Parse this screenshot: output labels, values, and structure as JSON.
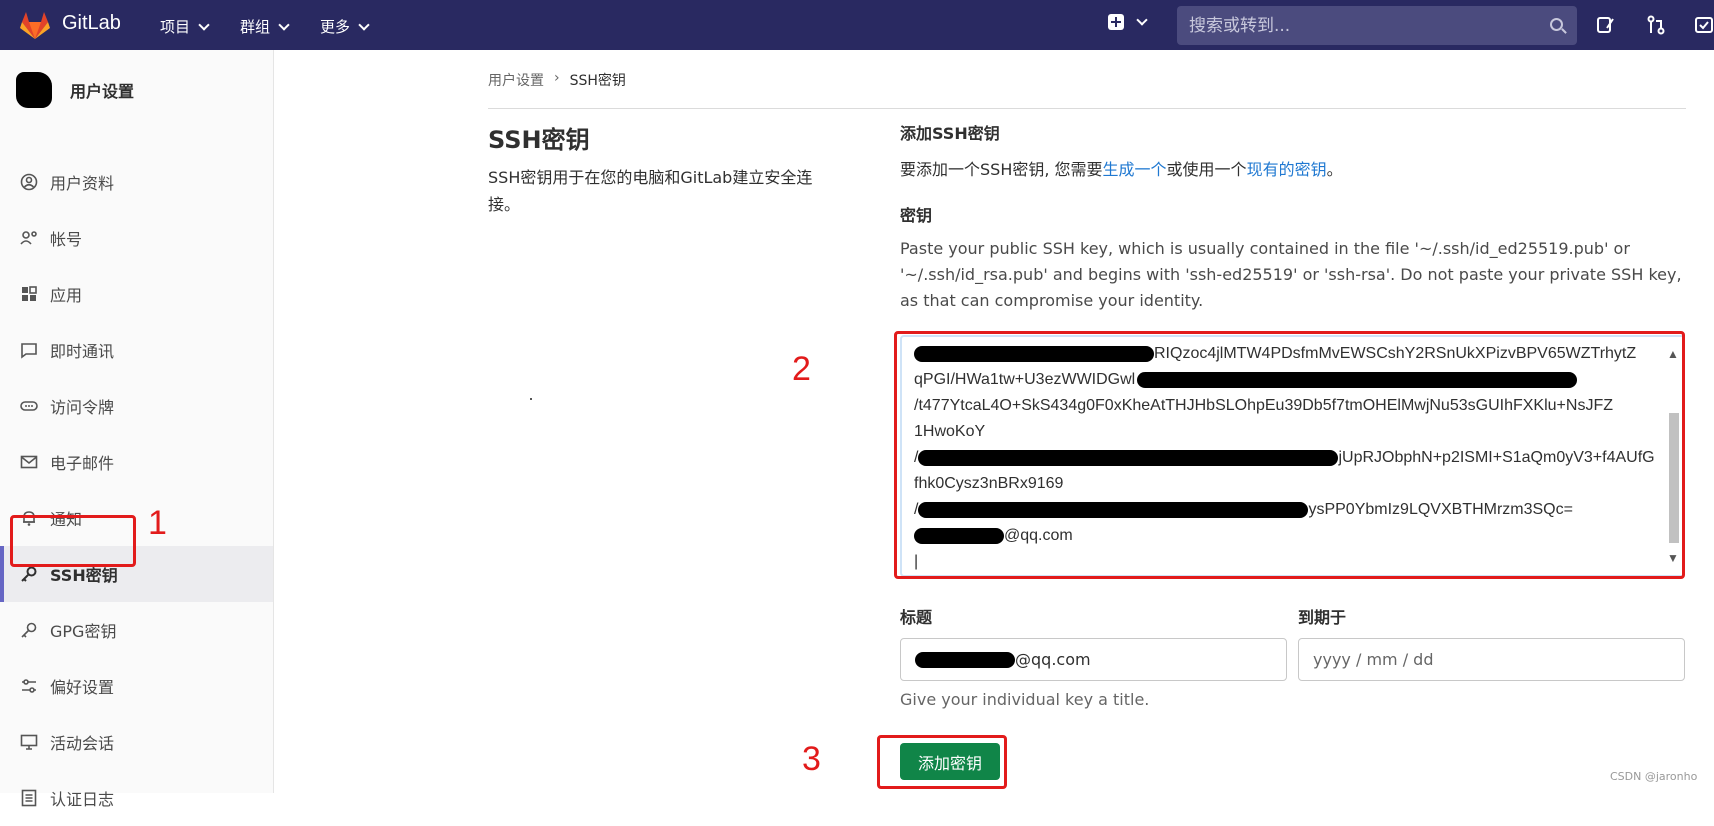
{
  "topbar": {
    "brand": "GitLab",
    "menus": [
      "项目",
      "群组",
      "更多"
    ],
    "search_placeholder": "搜索或转到..."
  },
  "sidebar": {
    "title": "用户设置",
    "items": [
      {
        "label": "用户资料",
        "icon": "profile-icon"
      },
      {
        "label": "帐号",
        "icon": "account-icon"
      },
      {
        "label": "应用",
        "icon": "applications-icon"
      },
      {
        "label": "即时通讯",
        "icon": "chat-icon"
      },
      {
        "label": "访问令牌",
        "icon": "token-icon"
      },
      {
        "label": "电子邮件",
        "icon": "email-icon"
      },
      {
        "label": "通知",
        "icon": "notifications-icon"
      },
      {
        "label": "SSH密钥",
        "icon": "key-icon",
        "active": true
      },
      {
        "label": "GPG密钥",
        "icon": "key-icon"
      },
      {
        "label": "偏好设置",
        "icon": "preferences-icon"
      },
      {
        "label": "活动会话",
        "icon": "sessions-icon"
      },
      {
        "label": "认证日志",
        "icon": "log-icon"
      }
    ]
  },
  "breadcrumb": {
    "parent": "用户设置",
    "current": "SSH密钥"
  },
  "section": {
    "title": "SSH密钥",
    "description": "SSH密钥用于在您的电脑和GitLab建立安全连接。"
  },
  "add_key": {
    "title": "添加SSH密钥",
    "desc_prefix": "要添加一个SSH密钥, 您需要",
    "link1": "生成一个",
    "desc_mid": "或使用一个",
    "link2": "现有的密钥",
    "desc_suffix": "。",
    "key_label": "密钥",
    "key_help": "Paste your public SSH key, which is usually contained in the file '~/.ssh/id_ed25519.pub' or '~/.ssh/id_rsa.pub' and begins with 'ssh-ed25519' or 'ssh-rsa'. Do not paste your private SSH key, as that can compromise your identity.",
    "key_lines": [
      "RIQzoc4jlMTW4PDsfmMvEWSCshY2RSnUkXPizvBPV65WZTrhytZ",
      "qPGI/HWa1tw+U3ezWWIDGwl",
      "/t477YtcaL4O+SkS434g0F0xKheAtTHJHbSLOhpEu39Db5f7tmOHElMwjNu53sGUIhFXKlu+NsJFZ",
      "1HwoKoY",
      "jUpRJObphN+p2ISMI+S1aQm0yV3+f4AUfG",
      "fhk0Cysz3nBRx9169",
      "ysPP0YbmIz9LQVXBTHMrzm3SQc=",
      "@qq.com"
    ],
    "title_label": "标题",
    "title_value": "@qq.com",
    "expires_label": "到期于",
    "expires_placeholder": "yyyy / mm / dd",
    "title_help": "Give your individual key a title.",
    "submit_label": "添加密钥"
  },
  "annotations": [
    "1",
    "2",
    "3"
  ],
  "watermark": "CSDN @jaronho",
  "colors": {
    "navbar": "#292961",
    "submit": "#108548",
    "annotation": "#e21b1b",
    "link": "#1f78d1"
  }
}
